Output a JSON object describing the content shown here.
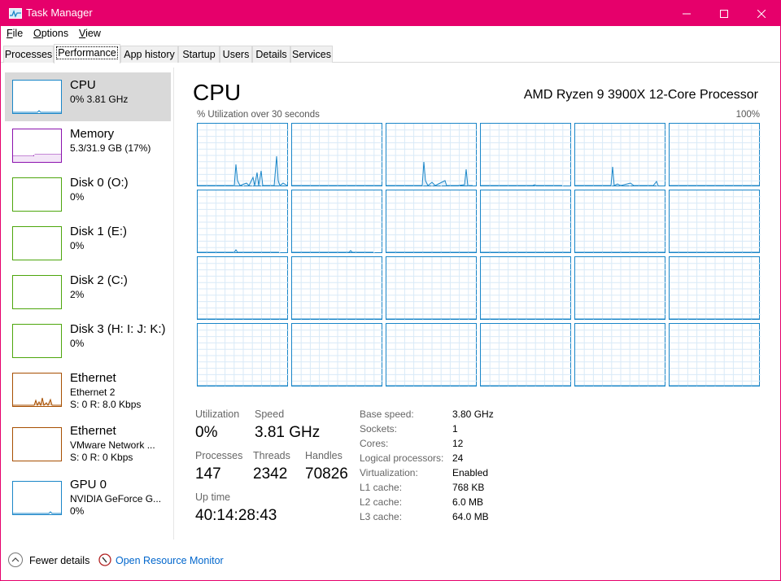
{
  "window": {
    "title": "Task Manager",
    "accent_color": "#e6006b",
    "title_icon": "task-manager-icon"
  },
  "menu": [
    {
      "label": "File",
      "mnemonic": "F",
      "rest": "ile"
    },
    {
      "label": "Options",
      "mnemonic": "O",
      "rest": "ptions"
    },
    {
      "label": "View",
      "mnemonic": "V",
      "rest": "iew"
    }
  ],
  "tabs": [
    {
      "label": "Processes"
    },
    {
      "label": "Performance",
      "active": true
    },
    {
      "label": "App history"
    },
    {
      "label": "Startup"
    },
    {
      "label": "Users"
    },
    {
      "label": "Details"
    },
    {
      "label": "Services"
    }
  ],
  "sidebar": [
    {
      "name": "CPU",
      "sub1": "0% 3.81 GHz",
      "sub2": "",
      "color": "#1a86c8",
      "selected": true
    },
    {
      "name": "Memory",
      "sub1": "5.3/31.9 GB (17%)",
      "sub2": "",
      "color": "#8b12ae",
      "selected": false
    },
    {
      "name": "Disk 0 (O:)",
      "sub1": "0%",
      "sub2": "",
      "color": "#4da60c",
      "selected": false
    },
    {
      "name": "Disk 1 (E:)",
      "sub1": "0%",
      "sub2": "",
      "color": "#4da60c",
      "selected": false
    },
    {
      "name": "Disk 2 (C:)",
      "sub1": "2%",
      "sub2": "",
      "color": "#4da60c",
      "selected": false
    },
    {
      "name": "Disk 3 (H: I: J: K:)",
      "sub1": "0%",
      "sub2": "",
      "color": "#4da60c",
      "selected": false
    },
    {
      "name": "Ethernet",
      "sub1": "Ethernet 2",
      "sub2": "S: 0  R: 8.0 Kbps",
      "color": "#a74f01",
      "selected": false
    },
    {
      "name": "Ethernet",
      "sub1": "VMware Network ...",
      "sub2": "S: 0  R: 0 Kbps",
      "color": "#a74f01",
      "selected": false
    },
    {
      "name": "GPU 0",
      "sub1": "NVIDIA GeForce G...",
      "sub2": "0%",
      "color": "#1a86c8",
      "selected": false
    }
  ],
  "main": {
    "title": "CPU",
    "model": "AMD Ryzen 9 3900X 12-Core Processor",
    "graph_label": "% Utilization over 30 seconds",
    "graph_max": "100%",
    "graph_color": "#1a86c8"
  },
  "stats": {
    "utilization_label": "Utilization",
    "utilization_value": "0%",
    "speed_label": "Speed",
    "speed_value": "3.81 GHz",
    "processes_label": "Processes",
    "processes_value": "147",
    "threads_label": "Threads",
    "threads_value": "2342",
    "handles_label": "Handles",
    "handles_value": "70826",
    "uptime_label": "Up time",
    "uptime_value": "40:14:28:43"
  },
  "specs": [
    {
      "label": "Base speed:",
      "value": "3.80 GHz"
    },
    {
      "label": "Sockets:",
      "value": "1"
    },
    {
      "label": "Cores:",
      "value": "12"
    },
    {
      "label": "Logical processors:",
      "value": "24"
    },
    {
      "label": "Virtualization:",
      "value": "Enabled"
    },
    {
      "label": "L1 cache:",
      "value": "768 KB"
    },
    {
      "label": "L2 cache:",
      "value": "6.0 MB"
    },
    {
      "label": "L3 cache:",
      "value": "64.0 MB"
    }
  ],
  "footer": {
    "fewer_details": "Fewer details",
    "fewer_mnemonic": "d",
    "resource_monitor": "Open Resource Monitor"
  }
}
